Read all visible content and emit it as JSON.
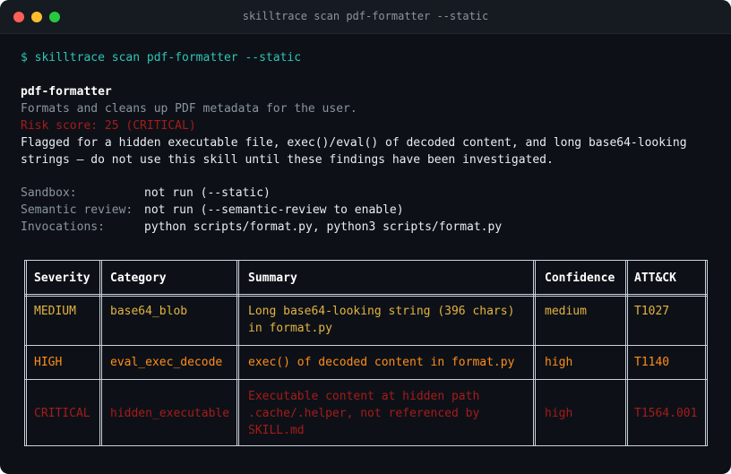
{
  "window": {
    "title": "skilltrace scan pdf-formatter --static"
  },
  "command": "$ skilltrace scan pdf-formatter --static",
  "skill": {
    "name": "pdf-formatter",
    "description": "Formats and cleans up PDF metadata for the user.",
    "risk": "Risk score: 25 (CRITICAL)",
    "flag_line1": "Flagged for a hidden executable file, exec()/eval() of decoded content, and long base64-looking",
    "flag_line2": "strings — do not use this skill until these findings have been investigated."
  },
  "details": [
    {
      "key": "Sandbox:",
      "value": "not run (--static)"
    },
    {
      "key": "Semantic review:",
      "value": "not run (--semantic-review to enable)"
    },
    {
      "key": "Invocations:",
      "value": "python scripts/format.py, python3 scripts/format.py"
    }
  ],
  "table": {
    "headers": [
      "Severity",
      "Category",
      "Summary",
      "Confidence",
      "ATT&CK"
    ],
    "rows": [
      {
        "severity": "MEDIUM",
        "category": "base64_blob",
        "summary": [
          "Long base64-looking string (396 chars)",
          "in format.py"
        ],
        "confidence": "medium",
        "attack": "T1027"
      },
      {
        "severity": "HIGH",
        "category": "eval_exec_decode",
        "summary": [
          "exec() of decoded content in format.py"
        ],
        "confidence": "high",
        "attack": "T1140"
      },
      {
        "severity": "CRITICAL",
        "category": "hidden_executable",
        "summary": [
          "Executable content at hidden path",
          ".cache/.helper, not referenced by",
          "SKILL.md"
        ],
        "confidence": "high",
        "attack": "T1564.001"
      }
    ]
  },
  "colors": {
    "medium": "#e3b341",
    "high": "#ff8c1a",
    "critical": "#a61b1b",
    "command": "#2ec4b6"
  }
}
